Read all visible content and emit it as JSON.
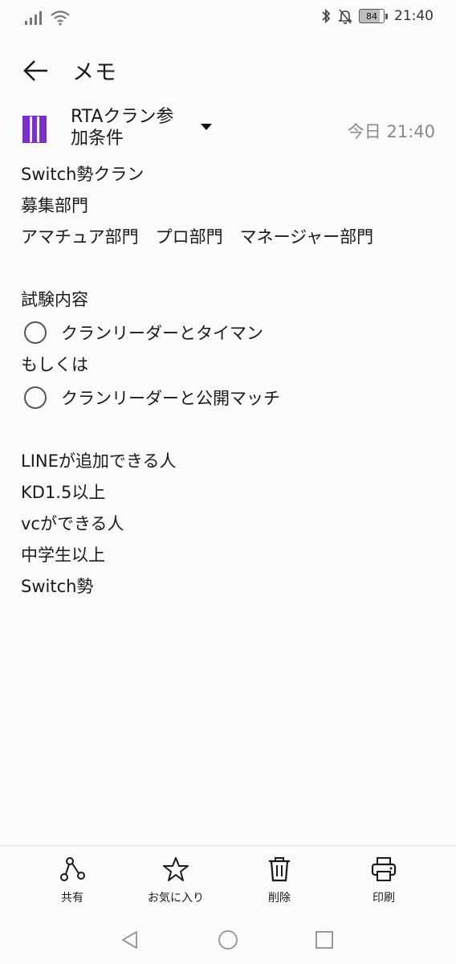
{
  "status_bar": {
    "time": "21:40",
    "battery": "84",
    "icons": [
      "signal-icon",
      "wifi-icon",
      "bluetooth-icon",
      "bell-off-icon",
      "battery-icon"
    ]
  },
  "header": {
    "title": "メモ",
    "back_icon": "arrow-left-icon"
  },
  "note": {
    "folder_name": "RTAクラン参加条件",
    "folder_color": "#7b2fd0",
    "timestamp": "今日 21:40",
    "lines": {
      "l1": "Switch勢クラン",
      "l2": "募集部門",
      "l3": "アマチュア部門　プロ部門　マネージャー部門",
      "l4": "試験内容",
      "c1": "クランリーダーとタイマン",
      "l5": "もしくは",
      "c2": "クランリーダーと公開マッチ",
      "l6": "LINEが追加できる人",
      "l7": "KD1.5以上",
      "l8": "vcができる人",
      "l9": "中学生以上",
      "l10": "Switch勢"
    }
  },
  "toolbar": {
    "share": "共有",
    "favorite": "お気に入り",
    "delete": "削除",
    "print": "印刷"
  },
  "nav": {
    "icons": [
      "back-triangle-icon",
      "home-circle-icon",
      "recents-square-icon"
    ]
  }
}
